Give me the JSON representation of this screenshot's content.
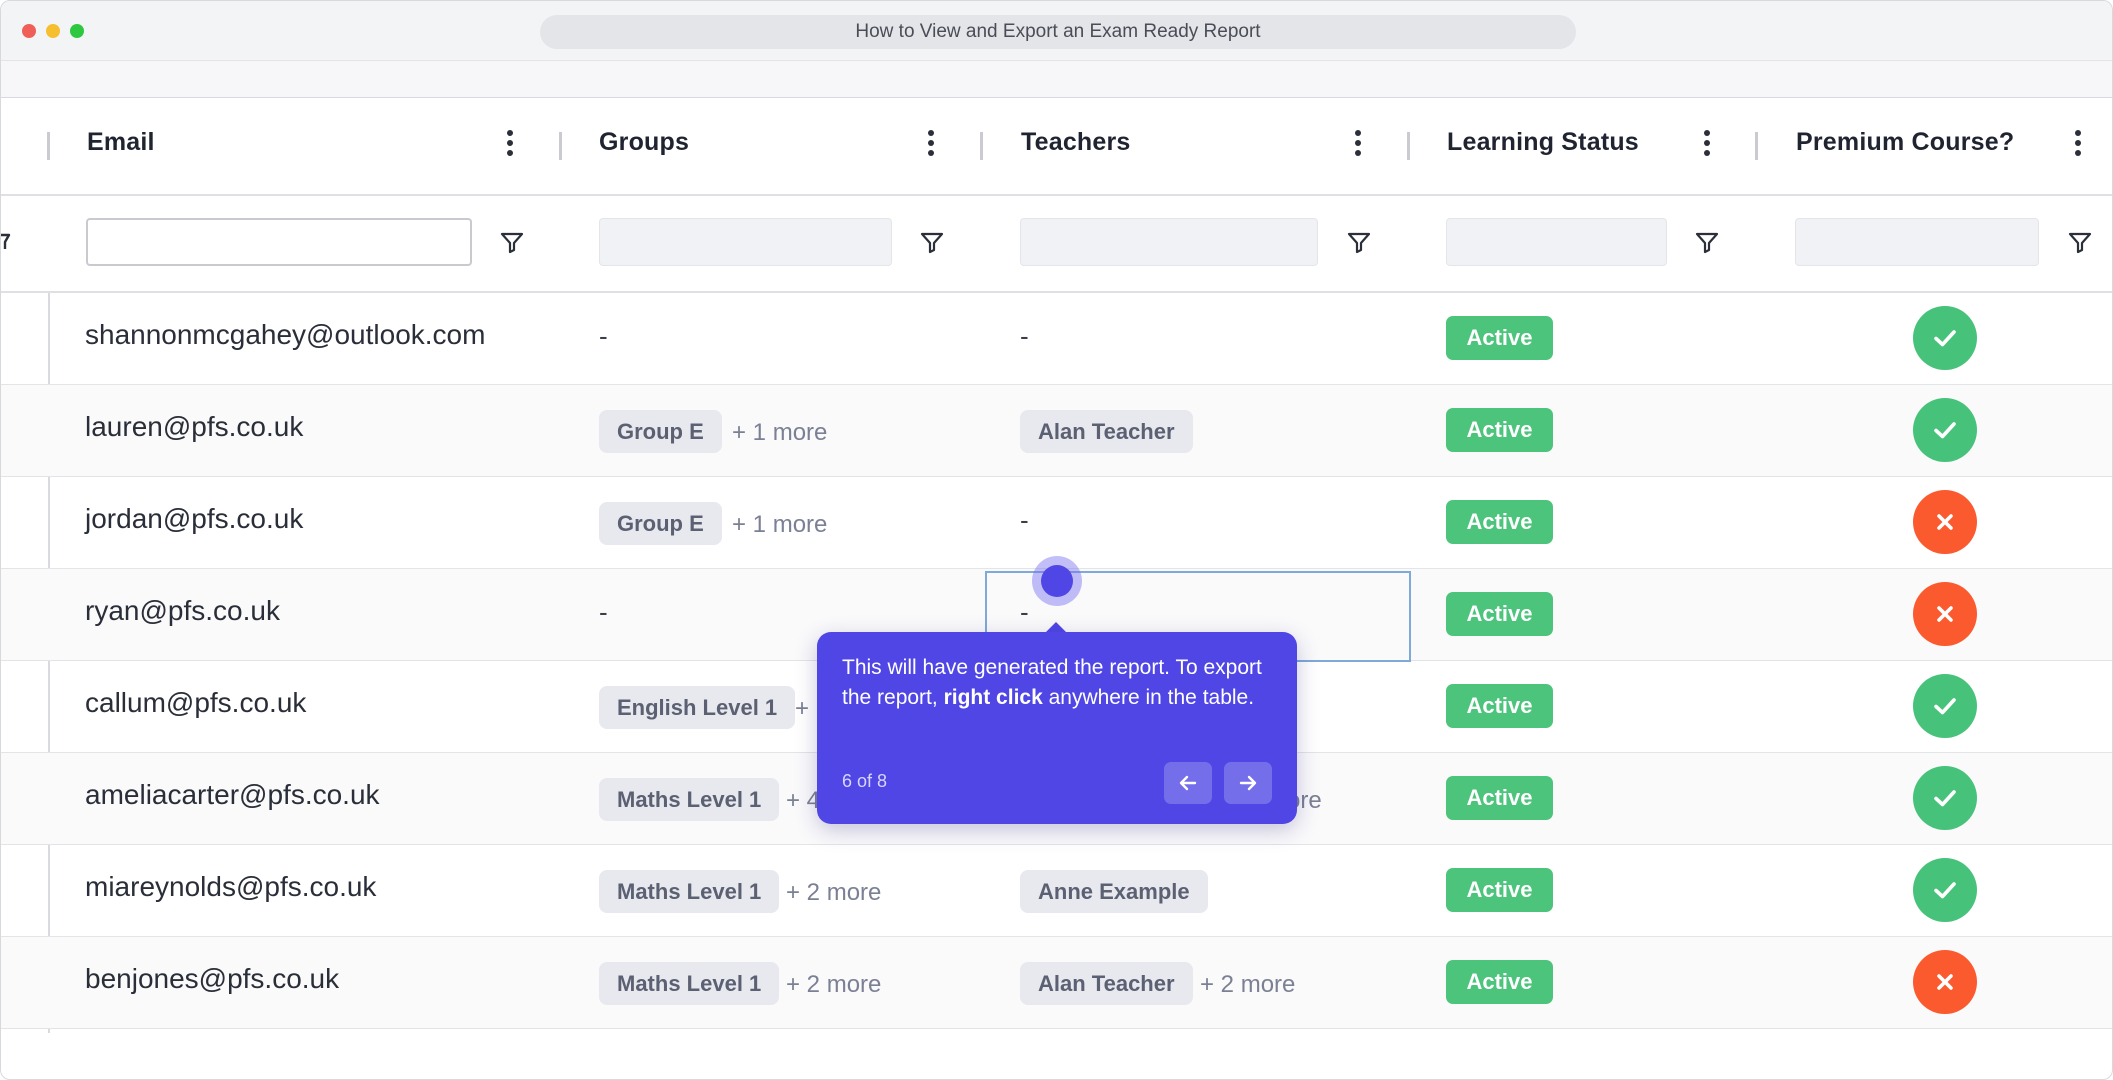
{
  "window": {
    "title": "How to View and Export an Exam Ready Report"
  },
  "columns": [
    {
      "title": "Email"
    },
    {
      "title": "Groups"
    },
    {
      "title": "Teachers"
    },
    {
      "title": "Learning Status"
    },
    {
      "title": "Premium Course?"
    }
  ],
  "filters": {
    "email_value": "",
    "groups_value": "",
    "teachers_value": "",
    "status_value": "",
    "premium_value": ""
  },
  "rows": [
    {
      "email": "shannonmcgahey@outlook.com",
      "groups_empty": "-",
      "teachers_empty": "-",
      "status": "Active",
      "premium": "yes"
    },
    {
      "email": "lauren@pfs.co.uk",
      "group": "Group E",
      "groups_more": "+ 1 more",
      "teacher": "Alan Teacher",
      "status": "Active",
      "premium": "yes"
    },
    {
      "email": "jordan@pfs.co.uk",
      "group": "Group E",
      "groups_more": "+ 1 more",
      "teachers_empty": "-",
      "status": "Active",
      "premium": "no"
    },
    {
      "email": "ryan@pfs.co.uk",
      "groups_empty": "-",
      "teachers_empty": "-",
      "status": "Active",
      "premium": "no"
    },
    {
      "email": "callum@pfs.co.uk",
      "group": "English Level 1",
      "groups_more": "+",
      "status": "Active",
      "premium": "yes"
    },
    {
      "email": "ameliacarter@pfs.co.uk",
      "group": "Maths Level 1",
      "groups_more": "+ 4",
      "teachers_more": "ore",
      "status": "Active",
      "premium": "yes"
    },
    {
      "email": "miareynolds@pfs.co.uk",
      "group": "Maths Level 1",
      "groups_more": "+ 2 more",
      "teacher": "Anne Example",
      "status": "Active",
      "premium": "yes"
    },
    {
      "email": "benjones@pfs.co.uk",
      "group": "Maths Level 1",
      "groups_more": "+ 2 more",
      "teacher": "Alan Teacher",
      "teachers_more": "+ 2 more",
      "status": "Active",
      "premium": "no"
    }
  ],
  "tooltip": {
    "text_before": "This will have generated the report. To export the report, ",
    "text_bold": "right click",
    "text_after": " anywhere in the table.",
    "step": "6 of 8",
    "prev_icon": "arrow-left-icon",
    "next_icon": "arrow-right-icon"
  },
  "colors": {
    "accent": "#4f46e5",
    "active_badge": "#4cc47c",
    "premium_yes": "#47c27a",
    "premium_no": "#fb5a2f"
  }
}
